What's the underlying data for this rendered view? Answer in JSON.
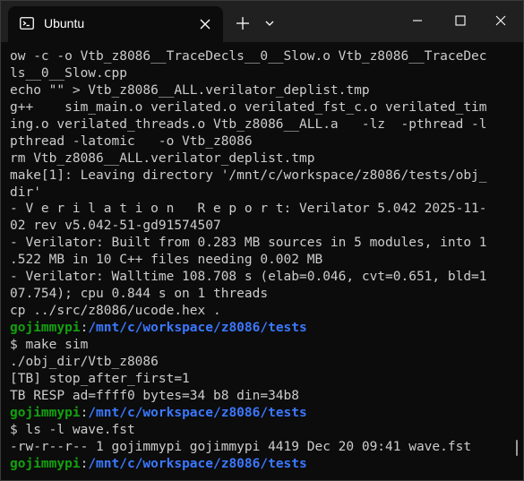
{
  "window": {
    "tab_title": "Ubuntu",
    "tab_icon": "terminal-icon",
    "close_tab_icon": "close-icon",
    "new_tab_icon": "plus-icon",
    "dropdown_icon": "chevron-down-icon",
    "minimize_icon": "minimize-icon",
    "maximize_icon": "maximize-icon",
    "close_window_icon": "close-icon"
  },
  "colors": {
    "background": "#0c0c0c",
    "titlebar": "#202020",
    "text": "#cccccc",
    "prompt_user": "#13a10e",
    "prompt_path": "#3b78ff"
  },
  "terminal": {
    "lines": [
      {
        "type": "text",
        "text": "ow -c -o Vtb_z8086__TraceDecls__0__Slow.o Vtb_z8086__TraceDec"
      },
      {
        "type": "text",
        "text": "ls__0__Slow.cpp"
      },
      {
        "type": "text",
        "text": "echo \"\" > Vtb_z8086__ALL.verilator_deplist.tmp"
      },
      {
        "type": "text",
        "text": "g++    sim_main.o verilated.o verilated_fst_c.o verilated_tim"
      },
      {
        "type": "text",
        "text": "ing.o verilated_threads.o Vtb_z8086__ALL.a   -lz  -pthread -l"
      },
      {
        "type": "text",
        "text": "pthread -latomic   -o Vtb_z8086"
      },
      {
        "type": "text",
        "text": "rm Vtb_z8086__ALL.verilator_deplist.tmp"
      },
      {
        "type": "text",
        "text": "make[1]: Leaving directory '/mnt/c/workspace/z8086/tests/obj_"
      },
      {
        "type": "text",
        "text": "dir'"
      },
      {
        "type": "text",
        "text": "- V e r i l a t i o n   R e p o r t: Verilator 5.042 2025-11-"
      },
      {
        "type": "text",
        "text": "02 rev v5.042-51-gd91574507"
      },
      {
        "type": "text",
        "text": "- Verilator: Built from 0.283 MB sources in 5 modules, into 1"
      },
      {
        "type": "text",
        "text": ".522 MB in 10 C++ files needing 0.002 MB"
      },
      {
        "type": "text",
        "text": "- Verilator: Walltime 108.708 s (elab=0.046, cvt=0.651, bld=1"
      },
      {
        "type": "text",
        "text": "07.754); cpu 0.844 s on 1 threads"
      },
      {
        "type": "text",
        "text": "cp ../src/z8086/ucode.hex ."
      },
      {
        "type": "prompt",
        "user": "gojimmypi",
        "colon": ":",
        "path": "/mnt/c/workspace/z8086/tests"
      },
      {
        "type": "text",
        "text": "$ make sim"
      },
      {
        "type": "text",
        "text": "./obj_dir/Vtb_z8086"
      },
      {
        "type": "text",
        "text": "[TB] stop_after_first=1"
      },
      {
        "type": "text",
        "text": "TB RESP ad=ffff0 bytes=34 b8 din=34b8"
      },
      {
        "type": "prompt",
        "user": "gojimmypi",
        "colon": ":",
        "path": "/mnt/c/workspace/z8086/tests"
      },
      {
        "type": "text",
        "text": "$ ls -l wave.fst"
      },
      {
        "type": "text",
        "text": "-rw-r--r-- 1 gojimmypi gojimmypi 4419 Dec 20 09:41 wave.fst"
      },
      {
        "type": "prompt",
        "user": "gojimmypi",
        "colon": ":",
        "path": "/mnt/c/workspace/z8086/tests"
      }
    ]
  }
}
